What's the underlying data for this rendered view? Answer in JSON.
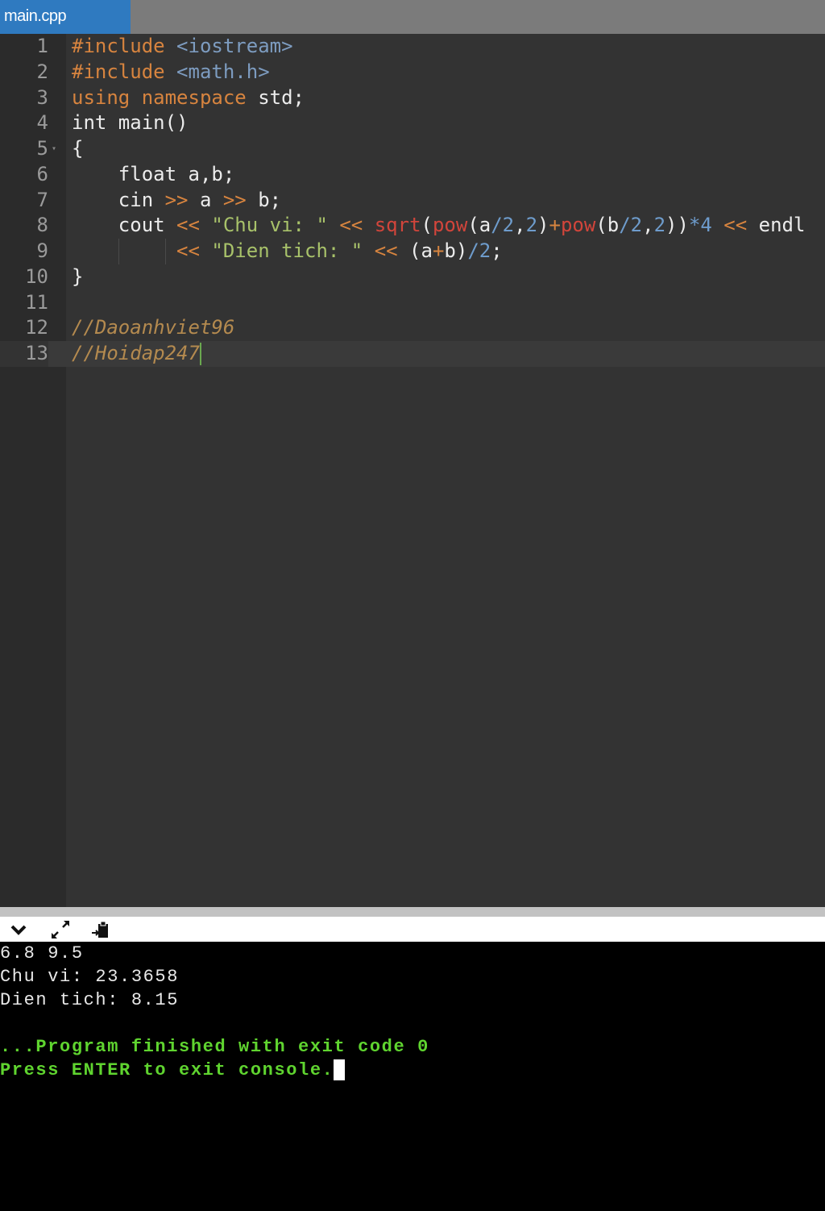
{
  "tab": {
    "label": "main.cpp"
  },
  "editor": {
    "lines": [
      {
        "n": "1",
        "tokens": [
          [
            "#include",
            "kw"
          ],
          [
            " ",
            "id"
          ],
          [
            "<iostream>",
            "inc"
          ]
        ]
      },
      {
        "n": "2",
        "tokens": [
          [
            "#include",
            "kw"
          ],
          [
            " ",
            "id"
          ],
          [
            "<math.h>",
            "inc"
          ]
        ]
      },
      {
        "n": "3",
        "tokens": [
          [
            "using",
            "kw"
          ],
          [
            " ",
            "id"
          ],
          [
            "namespace",
            "kw"
          ],
          [
            " std;",
            "id"
          ]
        ]
      },
      {
        "n": "4",
        "tokens": [
          [
            "int main()",
            "id"
          ]
        ]
      },
      {
        "n": "5",
        "fold": true,
        "tokens": [
          [
            "{",
            "id"
          ]
        ]
      },
      {
        "n": "6",
        "tokens": [
          [
            "    float a,b;",
            "id"
          ]
        ]
      },
      {
        "n": "7",
        "tokens": [
          [
            "    cin ",
            "id"
          ],
          [
            ">>",
            "op"
          ],
          [
            " a ",
            "id"
          ],
          [
            ">>",
            "op"
          ],
          [
            " b;",
            "id"
          ]
        ]
      },
      {
        "n": "8",
        "tokens": [
          [
            "    cout ",
            "id"
          ],
          [
            "<<",
            "op"
          ],
          [
            " ",
            "id"
          ],
          [
            "\"Chu vi: \"",
            "str"
          ],
          [
            " ",
            "id"
          ],
          [
            "<<",
            "op"
          ],
          [
            " ",
            "id"
          ],
          [
            "sqrt",
            "fn"
          ],
          [
            "(",
            "id"
          ],
          [
            "pow",
            "fn"
          ],
          [
            "(a",
            "id"
          ],
          [
            "/2",
            "num"
          ],
          [
            ",",
            "id"
          ],
          [
            "2",
            "num"
          ],
          [
            ")",
            "id"
          ],
          [
            "+",
            "op"
          ],
          [
            "pow",
            "fn"
          ],
          [
            "(b",
            "id"
          ],
          [
            "/2",
            "num"
          ],
          [
            ",",
            "id"
          ],
          [
            "2",
            "num"
          ],
          [
            "))",
            "id"
          ],
          [
            "*4",
            "num"
          ],
          [
            " ",
            "id"
          ],
          [
            "<<",
            "op"
          ],
          [
            " endl",
            "id"
          ]
        ]
      },
      {
        "n": "9",
        "guides": true,
        "tokens": [
          [
            "         ",
            "id"
          ],
          [
            "<<",
            "op"
          ],
          [
            " ",
            "id"
          ],
          [
            "\"Dien tich: \"",
            "str"
          ],
          [
            " ",
            "id"
          ],
          [
            "<<",
            "op"
          ],
          [
            " (a",
            "id"
          ],
          [
            "+",
            "op"
          ],
          [
            "b)",
            "id"
          ],
          [
            "/2",
            "num"
          ],
          [
            ";",
            "id"
          ]
        ]
      },
      {
        "n": "10",
        "tokens": [
          [
            "}",
            "id"
          ]
        ]
      },
      {
        "n": "11",
        "tokens": []
      },
      {
        "n": "12",
        "tokens": [
          [
            "//Daoanhviet96",
            "cm"
          ]
        ]
      },
      {
        "n": "13",
        "active": true,
        "tokens": [
          [
            "//Hoidap247",
            "cm"
          ]
        ]
      }
    ]
  },
  "console": {
    "lines": [
      {
        "text": "6.8 9.5",
        "style": "normal"
      },
      {
        "text": "Chu vi: 23.3658",
        "style": "normal"
      },
      {
        "text": "Dien tich: 8.15",
        "style": "normal"
      },
      {
        "text": "",
        "style": "normal"
      },
      {
        "text": "...Program finished with exit code 0",
        "style": "green"
      },
      {
        "text": "Press ENTER to exit console.",
        "style": "green",
        "cursor": true
      }
    ]
  },
  "colors": {
    "tab_active": "#2f7ac0",
    "console_green": "#5fd42f"
  }
}
